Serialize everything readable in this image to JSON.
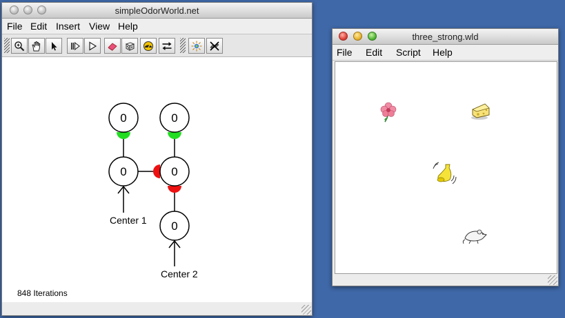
{
  "network_window": {
    "title": "simpleOdorWorld.net",
    "menus": [
      "File",
      "Edit",
      "Insert",
      "View",
      "Help"
    ],
    "toolbar_icons": [
      "zoom-icon",
      "hand-icon",
      "arrow-icon",
      "step-icon",
      "play-icon",
      "eraser-icon",
      "dice-icon",
      "gauge-icon",
      "swap-arrows-icon",
      "interaction-icon",
      "no-interaction-icon"
    ],
    "nodes": [
      {
        "id": "top-left",
        "value": "0"
      },
      {
        "id": "top-right",
        "value": "0"
      },
      {
        "id": "mid-left",
        "value": "0"
      },
      {
        "id": "mid-right",
        "value": "0"
      },
      {
        "id": "bottom-right",
        "value": "0"
      }
    ],
    "labels": {
      "center1": "Center 1",
      "center2": "Center 2"
    },
    "status": "848 Iterations",
    "colors": {
      "excitatory": "#22dd22",
      "inhibitory": "#ee1111"
    }
  },
  "world_window": {
    "title": "three_strong.wld",
    "menus": [
      "File",
      "Edit",
      "Script",
      "Help"
    ],
    "entities": [
      "flower-icon",
      "cheese-icon",
      "bell-icon",
      "mouse-icon"
    ]
  }
}
